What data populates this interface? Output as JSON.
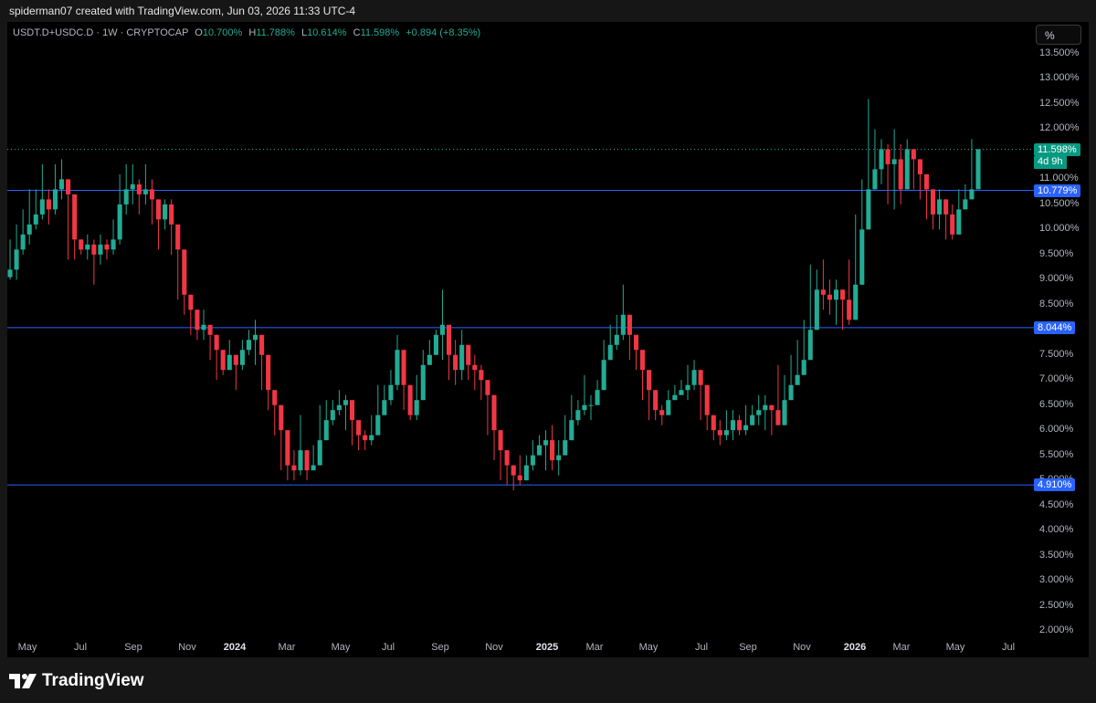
{
  "credit": "spiderman07 created with TradingView.com, Jun 03, 2026 11:33 UTC-4",
  "legend": {
    "symbol": "USDT.D+USDC.D · 1W · CRYPTOCAP",
    "o_label": "O",
    "o": "10.700%",
    "h_label": "H",
    "h": "11.788%",
    "l_label": "L",
    "l": "10.614%",
    "c_label": "C",
    "c": "11.598%",
    "change": "+0.894 (+8.35%)"
  },
  "scale_button": "%",
  "price_tag": {
    "value": "11.598%",
    "countdown": "4d 9h"
  },
  "brand": "TradingView",
  "colors": {
    "up": "#22ab94",
    "down": "#f23645",
    "level_line": "#2962ff",
    "background": "#000000"
  },
  "chart_data": {
    "type": "candlestick",
    "symbol": "USDT.D+USDC.D",
    "interval": "1W",
    "ylim": [
      1.8,
      13.8
    ],
    "y_unit": "%",
    "y_ticks": [
      "13.500%",
      "13.000%",
      "12.500%",
      "12.000%",
      "11.500%",
      "11.000%",
      "10.500%",
      "10.000%",
      "9.500%",
      "9.000%",
      "8.500%",
      "8.000%",
      "7.500%",
      "7.000%",
      "6.500%",
      "6.000%",
      "5.500%",
      "5.000%",
      "4.500%",
      "4.000%",
      "3.500%",
      "3.000%",
      "2.500%",
      "2.000%"
    ],
    "x_ticks": [
      {
        "label": "May",
        "bold": false
      },
      {
        "label": "Jul",
        "bold": false
      },
      {
        "label": "Sep",
        "bold": false
      },
      {
        "label": "Nov",
        "bold": false
      },
      {
        "label": "2024",
        "bold": true
      },
      {
        "label": "Mar",
        "bold": false
      },
      {
        "label": "May",
        "bold": false
      },
      {
        "label": "Jul",
        "bold": false
      },
      {
        "label": "Sep",
        "bold": false
      },
      {
        "label": "Nov",
        "bold": false
      },
      {
        "label": "2025",
        "bold": true
      },
      {
        "label": "Mar",
        "bold": false
      },
      {
        "label": "May",
        "bold": false
      },
      {
        "label": "Jul",
        "bold": false
      },
      {
        "label": "Sep",
        "bold": false
      },
      {
        "label": "Nov",
        "bold": false
      },
      {
        "label": "2026",
        "bold": true
      },
      {
        "label": "Mar",
        "bold": false
      },
      {
        "label": "May",
        "bold": false
      },
      {
        "label": "Jul",
        "bold": false
      }
    ],
    "horizontal_levels": [
      {
        "value": 10.779,
        "label": "10.779%"
      },
      {
        "value": 8.044,
        "label": "8.044%"
      },
      {
        "value": 4.91,
        "label": "4.910%"
      }
    ],
    "last_price": 11.598,
    "closes": [
      9.2,
      9.6,
      9.9,
      10.1,
      10.3,
      10.6,
      10.4,
      10.8,
      11.0,
      10.7,
      9.8,
      9.6,
      9.7,
      9.5,
      9.7,
      9.6,
      9.8,
      10.5,
      10.8,
      10.9,
      10.7,
      10.8,
      10.6,
      10.2,
      10.5,
      10.1,
      9.6,
      8.7,
      8.4,
      8.0,
      8.1,
      7.9,
      7.6,
      7.2,
      7.5,
      7.3,
      7.6,
      7.8,
      7.9,
      7.5,
      6.8,
      6.5,
      6.0,
      5.3,
      5.2,
      5.6,
      5.2,
      5.3,
      5.8,
      6.2,
      6.4,
      6.5,
      6.6,
      6.2,
      5.9,
      5.8,
      5.9,
      6.3,
      6.6,
      6.9,
      7.6,
      6.9,
      6.3,
      6.6,
      7.3,
      7.5,
      7.9,
      8.1,
      7.5,
      7.2,
      7.7,
      7.3,
      7.2,
      7.0,
      6.7,
      6.0,
      5.6,
      5.3,
      5.1,
      5.0,
      5.3,
      5.5,
      5.7,
      5.8,
      5.4,
      5.5,
      5.8,
      6.2,
      6.4,
      6.5,
      6.5,
      6.8,
      7.4,
      7.7,
      7.9,
      8.3,
      7.9,
      7.6,
      7.2,
      6.8,
      6.4,
      6.3,
      6.6,
      6.7,
      6.8,
      6.9,
      7.2,
      6.9,
      6.3,
      6.0,
      5.9,
      6.0,
      6.2,
      6.0,
      6.1,
      6.3,
      6.4,
      6.5,
      6.4,
      6.1,
      6.6,
      6.9,
      7.1,
      7.4,
      8.0,
      8.8,
      8.7,
      8.6,
      8.8,
      8.6,
      8.2,
      8.9,
      10.0,
      10.8,
      11.2,
      11.6,
      11.3,
      11.4,
      10.8,
      11.6,
      11.4,
      11.1,
      10.8,
      10.3,
      10.6,
      10.3,
      9.9,
      10.4,
      10.6,
      10.8,
      11.6
    ],
    "highs": [
      9.8,
      10.1,
      10.4,
      10.8,
      10.8,
      11.3,
      10.8,
      11.3,
      11.4,
      10.9,
      10.0,
      9.8,
      9.9,
      9.8,
      9.9,
      9.8,
      10.2,
      11.1,
      11.3,
      11.3,
      11.0,
      11.3,
      11.0,
      10.5,
      10.6,
      10.6,
      9.8,
      8.9,
      8.6,
      8.2,
      8.4,
      8.1,
      7.8,
      7.5,
      7.8,
      7.5,
      7.8,
      8.0,
      8.2,
      7.9,
      7.0,
      6.8,
      6.2,
      5.5,
      5.6,
      6.3,
      5.6,
      5.7,
      6.5,
      6.6,
      6.6,
      6.8,
      6.7,
      6.4,
      6.1,
      6.0,
      6.3,
      6.9,
      6.9,
      7.2,
      7.9,
      7.5,
      6.9,
      7.1,
      7.6,
      7.8,
      8.0,
      8.8,
      8.0,
      7.8,
      8.0,
      7.7,
      7.5,
      7.3,
      7.0,
      6.3,
      5.9,
      5.5,
      5.3,
      5.5,
      5.5,
      5.8,
      5.9,
      6.0,
      6.1,
      5.8,
      6.3,
      6.7,
      6.6,
      7.1,
      6.7,
      7.0,
      7.8,
      8.1,
      8.3,
      8.9,
      8.3,
      7.8,
      7.4,
      7.1,
      6.6,
      6.5,
      6.8,
      6.9,
      7.0,
      7.3,
      7.4,
      7.2,
      6.5,
      6.2,
      6.2,
      6.4,
      6.4,
      6.3,
      6.5,
      6.5,
      6.7,
      6.7,
      6.5,
      7.3,
      7.1,
      7.5,
      7.8,
      8.2,
      9.3,
      9.2,
      9.4,
      9.0,
      9.0,
      8.8,
      9.4,
      10.3,
      11.0,
      12.6,
      12.0,
      11.8,
      11.7,
      12.0,
      11.7,
      11.8,
      11.6,
      11.4,
      11.0,
      10.8,
      10.8,
      10.4,
      10.5,
      10.8,
      10.9,
      11.8
    ],
    "lows": [
      9.0,
      9.0,
      9.5,
      9.7,
      10.0,
      10.2,
      10.1,
      10.3,
      10.6,
      9.4,
      9.4,
      9.5,
      9.4,
      8.9,
      9.3,
      9.4,
      9.5,
      9.7,
      10.3,
      10.5,
      10.3,
      10.5,
      10.1,
      9.6,
      10.0,
      9.5,
      8.6,
      8.3,
      7.9,
      7.8,
      7.8,
      7.4,
      7.0,
      7.1,
      7.3,
      6.8,
      7.2,
      7.5,
      7.3,
      6.8,
      6.4,
      5.9,
      5.2,
      5.0,
      5.0,
      5.1,
      5.0,
      5.2,
      5.6,
      6.0,
      6.1,
      6.3,
      6.0,
      5.7,
      5.6,
      5.6,
      5.7,
      6.1,
      6.4,
      6.5,
      6.8,
      6.4,
      6.2,
      6.2,
      7.0,
      7.3,
      7.5,
      7.4,
      7.0,
      6.9,
      7.0,
      7.0,
      6.8,
      6.6,
      5.9,
      5.4,
      5.0,
      4.9,
      4.8,
      4.9,
      5.1,
      5.2,
      5.5,
      5.2,
      5.2,
      5.1,
      5.5,
      5.9,
      6.1,
      6.3,
      6.2,
      6.5,
      7.2,
      7.5,
      7.6,
      7.8,
      7.4,
      7.2,
      6.6,
      6.2,
      6.2,
      6.1,
      6.3,
      6.6,
      6.7,
      6.6,
      6.8,
      6.2,
      6.0,
      5.8,
      5.7,
      5.8,
      5.8,
      5.9,
      5.9,
      6.2,
      6.1,
      6.0,
      5.9,
      6.1,
      6.6,
      6.8,
      7.0,
      7.3,
      7.9,
      8.3,
      8.4,
      8.3,
      8.1,
      8.0,
      8.1,
      8.8,
      9.9,
      10.5,
      11.0,
      10.9,
      10.5,
      10.4,
      10.5,
      10.8,
      10.8,
      10.6,
      10.2,
      10.0,
      10.0,
      9.8,
      9.8,
      10.3,
      10.5,
      10.6
    ]
  }
}
